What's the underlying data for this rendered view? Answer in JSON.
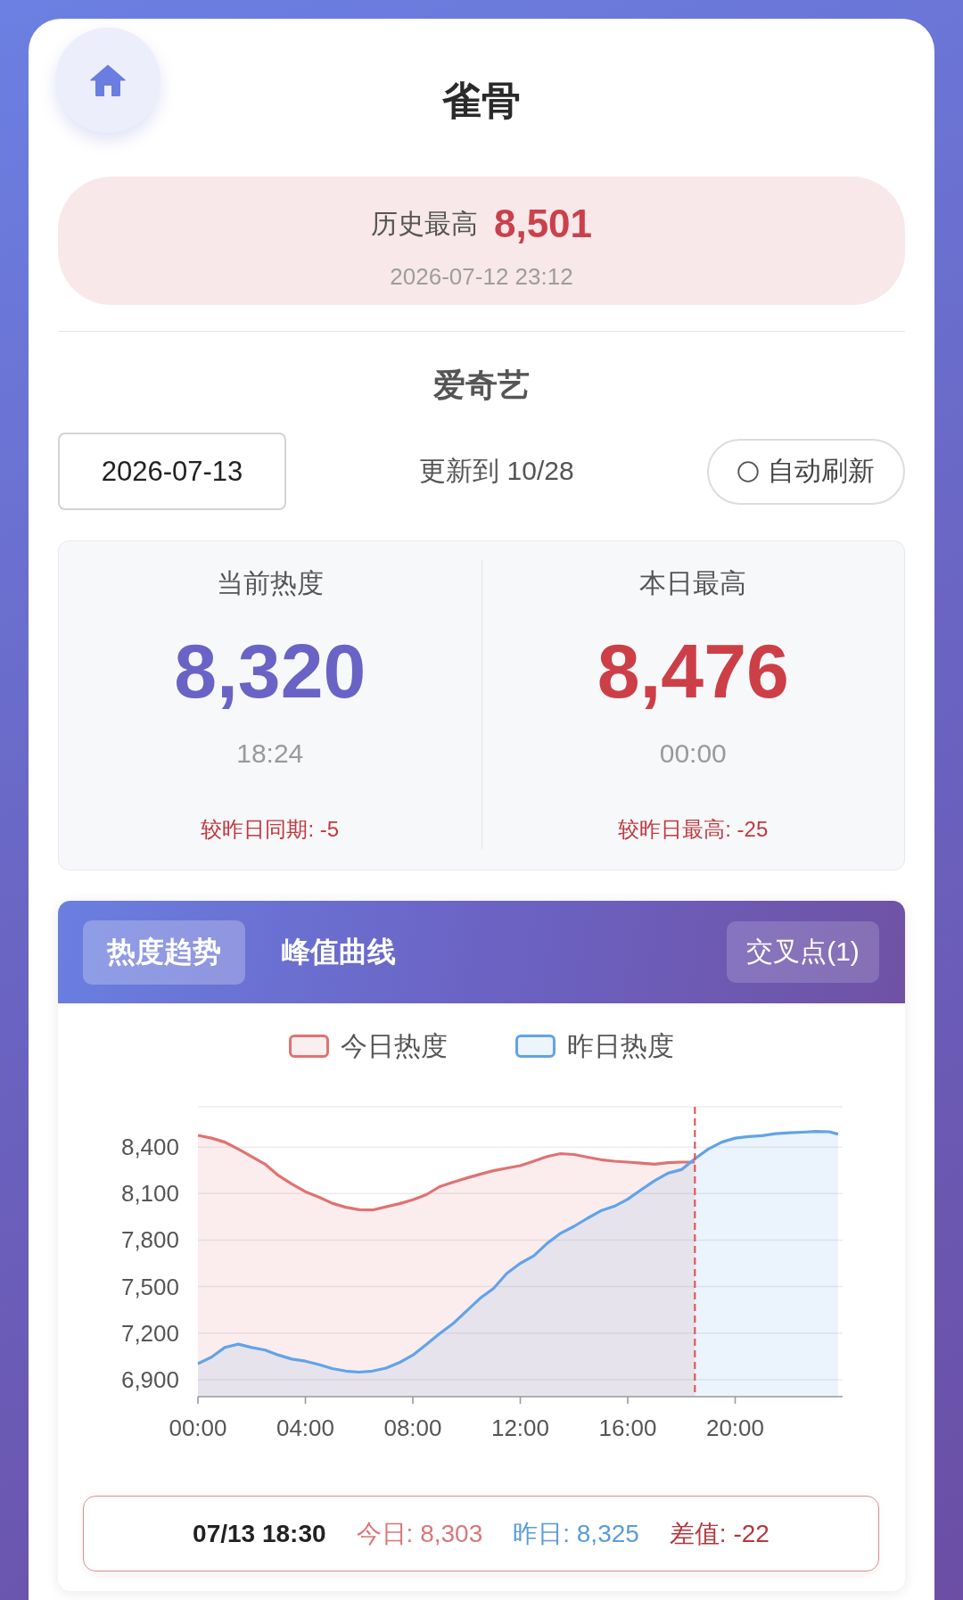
{
  "header": {
    "title": "雀骨"
  },
  "record": {
    "label": "历史最高",
    "value": "8,501",
    "time": "2026-07-12 23:12"
  },
  "platform": "爱奇艺",
  "controls": {
    "date": "2026-07-13",
    "update": "更新到 10/28",
    "auto_refresh": {
      "label": "自动刷新",
      "checked": false
    }
  },
  "stats": [
    {
      "kind": "current",
      "label": "当前热度",
      "value": "8,320",
      "time": "18:24",
      "compare": "较昨日同期: -5"
    },
    {
      "kind": "peak",
      "label": "本日最高",
      "value": "8,476",
      "time": "00:00",
      "compare": "较昨日最高: -25"
    }
  ],
  "chart_panel": {
    "tabs": [
      {
        "label": "热度趋势",
        "selected": true
      },
      {
        "label": "峰值曲线",
        "selected": false
      }
    ],
    "cross_button": "交叉点(1)",
    "chart_data": {
      "type": "area",
      "x": [
        0,
        0.5,
        1,
        1.5,
        2,
        2.5,
        3,
        3.5,
        4,
        4.5,
        5,
        5.5,
        6,
        6.5,
        7,
        7.5,
        8,
        8.5,
        9,
        9.5,
        10,
        10.5,
        11,
        11.5,
        12,
        12.5,
        13,
        13.5,
        14,
        14.5,
        15,
        15.5,
        16,
        16.5,
        17,
        17.5,
        18,
        18.5,
        19,
        19.5,
        20,
        20.5,
        21,
        21.5,
        22,
        22.5,
        23,
        23.5,
        23.83
      ],
      "series": [
        {
          "name": "今日热度",
          "color": "#e07272",
          "values": [
            8476,
            8458,
            8432,
            8387,
            8339,
            8290,
            8216,
            8161,
            8112,
            8077,
            8038,
            8012,
            7996,
            7994,
            8015,
            8035,
            8060,
            8093,
            8145,
            8174,
            8200,
            8225,
            8248,
            8264,
            8280,
            8309,
            8339,
            8358,
            8352,
            8335,
            8319,
            8309,
            8303,
            8297,
            8290,
            8300,
            8303,
            8303,
            null,
            null,
            null,
            null,
            null,
            null,
            null,
            null,
            null,
            null,
            null
          ]
        },
        {
          "name": "昨日热度",
          "color": "#62a3e8",
          "values": [
            7003,
            7045,
            7107,
            7129,
            7107,
            7091,
            7058,
            7032,
            7019,
            6997,
            6971,
            6955,
            6948,
            6955,
            6974,
            7010,
            7058,
            7126,
            7197,
            7262,
            7343,
            7424,
            7488,
            7585,
            7650,
            7698,
            7779,
            7844,
            7889,
            7941,
            7989,
            8018,
            8064,
            8125,
            8183,
            8232,
            8255,
            8325,
            8387,
            8432,
            8458,
            8468,
            8474,
            8487,
            8492,
            8496,
            8501,
            8499,
            8484
          ]
        }
      ],
      "xlim": [
        0,
        24
      ],
      "ylim": [
        6790,
        8660
      ],
      "xticks": [
        {
          "value": 0,
          "label": "00:00"
        },
        {
          "value": 4,
          "label": "04:00"
        },
        {
          "value": 8,
          "label": "08:00"
        },
        {
          "value": 12,
          "label": "12:00"
        },
        {
          "value": 16,
          "label": "16:00"
        },
        {
          "value": 20,
          "label": "20:00"
        }
      ],
      "yticks": [
        {
          "value": 6900,
          "label": "6,900"
        },
        {
          "value": 7200,
          "label": "7,200"
        },
        {
          "value": 7500,
          "label": "7,500"
        },
        {
          "value": 7800,
          "label": "7,800"
        },
        {
          "value": 8100,
          "label": "8,100"
        },
        {
          "value": 8400,
          "label": "8,400"
        }
      ],
      "grid": true,
      "ref_lines": [
        {
          "axis": "x",
          "value": 18.5,
          "color": "#e05858"
        }
      ]
    },
    "readout": {
      "time": "07/13 18:30",
      "items": [
        {
          "label": "今日: 8,303",
          "color": "#d9777a"
        },
        {
          "label": "昨日: 8,325",
          "color": "#5b9bd8"
        },
        {
          "label": "差值: -22",
          "color": "#b5363c"
        }
      ]
    }
  }
}
